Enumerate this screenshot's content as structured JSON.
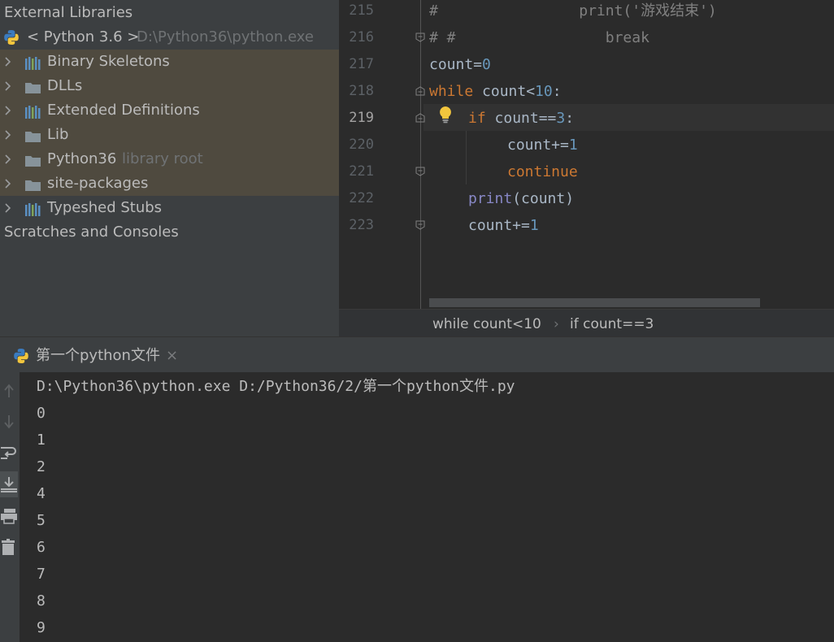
{
  "project": {
    "external_libraries": "External Libraries",
    "interpreter": {
      "name": "< Python 3.6 >",
      "path": "D:\\Python36\\python.exe"
    },
    "items": [
      {
        "label": "Binary Skeletons",
        "icon": "library-icon",
        "suffix": ""
      },
      {
        "label": "DLLs",
        "icon": "folder-icon",
        "suffix": ""
      },
      {
        "label": "Extended Definitions",
        "icon": "library-icon",
        "suffix": ""
      },
      {
        "label": "Lib",
        "icon": "folder-icon",
        "suffix": ""
      },
      {
        "label": "Python36",
        "icon": "folder-icon",
        "suffix": "library root"
      },
      {
        "label": "site-packages",
        "icon": "folder-icon",
        "suffix": ""
      },
      {
        "label": "Typeshed Stubs",
        "icon": "library-icon",
        "suffix": ""
      }
    ],
    "scratches": "Scratches and Consoles"
  },
  "editor": {
    "lines": [
      {
        "no": "215",
        "c1": "#",
        "c2": "                print('游戏结束')"
      },
      {
        "no": "216",
        "c1": "# #",
        "c2": "                 break"
      },
      {
        "no": "217",
        "a": "count=",
        "b": "0"
      },
      {
        "no": "218",
        "k": "while",
        "a": " count<",
        "b": "10",
        "d": ":"
      },
      {
        "no": "219",
        "k": "if",
        "a": " count==",
        "b": "3",
        "d": ":"
      },
      {
        "no": "220",
        "a": "count+=",
        "b": "1"
      },
      {
        "no": "221",
        "k": "continue"
      },
      {
        "no": "222",
        "f": "print",
        "a": "(count)"
      },
      {
        "no": "223",
        "a": "count+=",
        "b": "1"
      }
    ],
    "breadcrumb": {
      "first": "while count<10",
      "sep": "›",
      "second": "if count==3"
    }
  },
  "run": {
    "tab_label": "第一个python文件",
    "close": "×",
    "command": "D:\\Python36\\python.exe D:/Python36/2/第一个python文件.py",
    "output": [
      "0",
      "1",
      "2",
      "4",
      "5",
      "6",
      "7",
      "8",
      "9"
    ]
  },
  "colors": {
    "keyword": "#cc7832",
    "number": "#6897bb",
    "comment": "#808080",
    "builtin": "#8888c6",
    "highlight_row": "#4f4a3f",
    "background": "#2b2b2b"
  }
}
